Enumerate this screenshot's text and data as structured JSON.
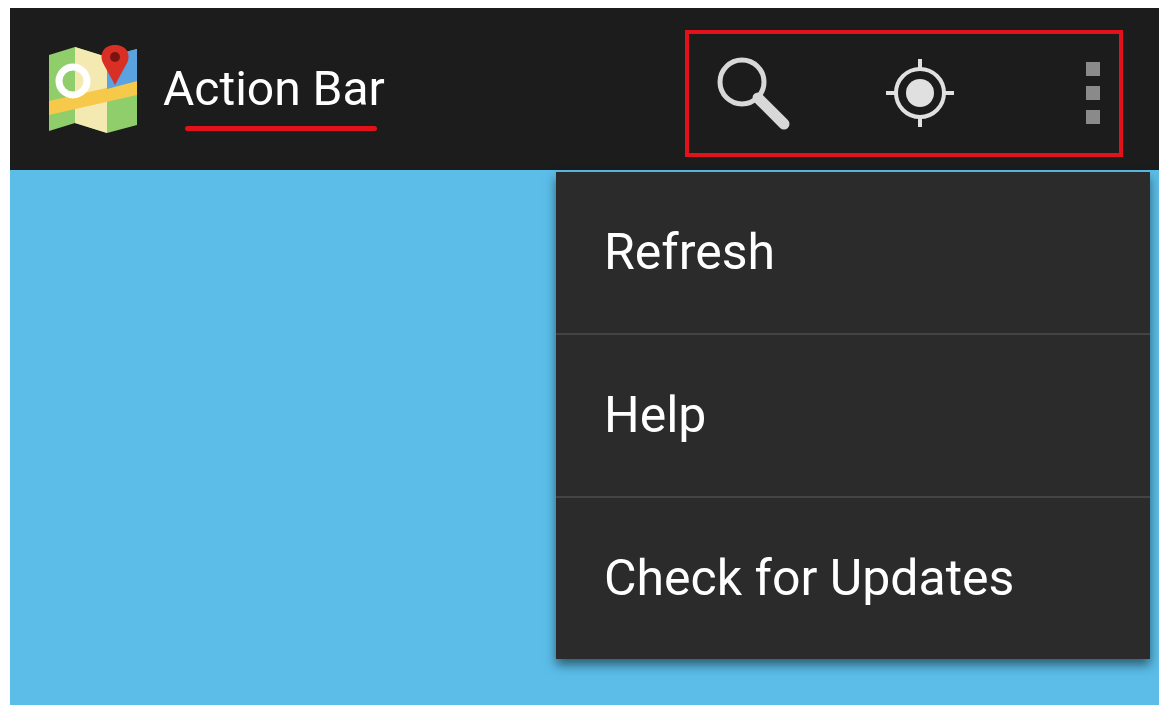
{
  "action_bar": {
    "title": "Action Bar"
  },
  "menu": {
    "items": [
      {
        "label": "Refresh"
      },
      {
        "label": "Help"
      },
      {
        "label": "Check for Updates"
      }
    ]
  }
}
